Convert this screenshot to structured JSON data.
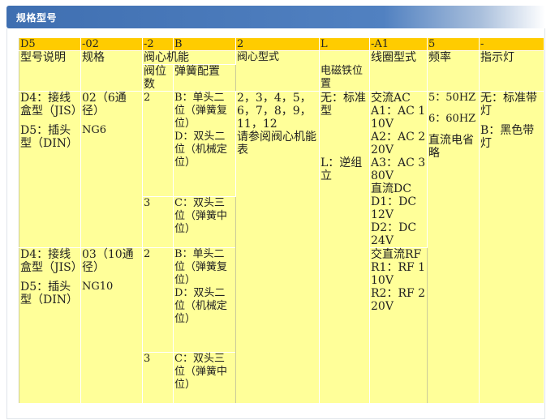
{
  "header": {
    "title": "规格型号"
  },
  "codes": [
    "D5",
    "-02",
    "-2",
    "B",
    "2",
    "L",
    "-A1",
    "5",
    "-"
  ],
  "headers": {
    "model_desc": "型号说明",
    "spec": "规格",
    "valve_function": "阀心机能",
    "valve_positions": "阀位数",
    "spring_config": "弹簧配置",
    "spool_type": "阀心型式",
    "solenoid_position": "电磁铁位置",
    "coil_type": "线圈型式",
    "frequency": "频率",
    "indicator": "指示灯"
  },
  "model_desc": {
    "d4": "D4：接线盒型（JIS）",
    "d5": "D5：插头型（DIN）"
  },
  "spec": {
    "s02": "02（6通径）",
    "ng6": "NG6",
    "s03": "03（10通径）",
    "ng10": "NG10"
  },
  "positions": {
    "two": "2",
    "three": "3"
  },
  "springs": {
    "b": "B：单头二位（弹簧复位）",
    "d": "D：双头二位（机械定位）",
    "c": "C：双头三位（弹簧中位）"
  },
  "spool": {
    "numbers": "2，3，4，5，6，7，8，9，11，12",
    "note": "请参阅阀心机能表"
  },
  "solenoid": {
    "none": "无：标准型",
    "l": "L：逆组立"
  },
  "coil": {
    "ac_title": "交流AC",
    "a1": "A1：AC 110V",
    "a2": "A2：AC 220V",
    "a3": "A3：AC 380V",
    "dc_title": "直流DC",
    "d1": "D1：DC 12V",
    "d2": "D2：DC 24V",
    "rf_title": "交直流RF",
    "r1": "R1：RF 110V",
    "r2": "R2：RF 220V"
  },
  "frequency": {
    "f5": "5：50HZ",
    "f6": "6：60HZ",
    "dc_note": "直流电省略"
  },
  "indicator": {
    "none": "无：标准带灯",
    "b": "B：黑色带灯"
  }
}
